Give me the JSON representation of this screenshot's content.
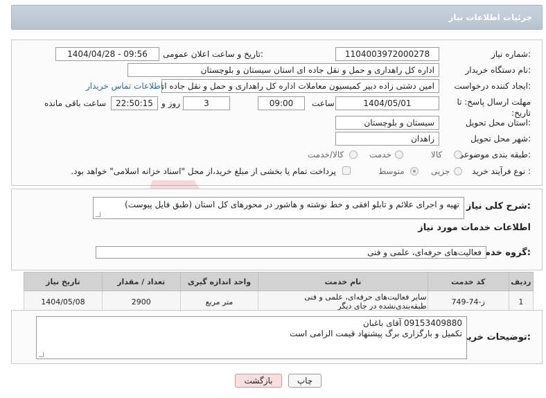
{
  "header": {
    "title": "جزئیات اطلاعات نیاز"
  },
  "form": {
    "need_number_label": "شماره نیاز:",
    "need_number": "1104003972000278",
    "announce_label": "تاریخ و ساعت اعلان عمومی:",
    "announce_value": "1404/04/28 - 09:56",
    "buyer_org_label": "نام دستگاه خریدار:",
    "buyer_org": "اداره کل راهداری و حمل و نقل جاده ای استان سیستان و بلوچستان",
    "requester_label": "ایجاد کننده درخواست:",
    "requester": "امین دشتی زاده دبیر کمیسیون معاملات اداره کل راهداری و حمل و نقل جاده ای",
    "contact_link": "اطلاعات تماس خریدار",
    "deadline_label": "مهلت ارسال پاسخ: تا تاریخ:",
    "deadline_date": "1404/05/01",
    "time_label": "ساعت",
    "deadline_time": "09:00",
    "days_value": "3",
    "days_label": "روز و",
    "remaining_time": "22:50:15",
    "remaining_label": "ساعت باقی مانده",
    "province_label": "استان محل تحویل:",
    "province": "سیستان و بلوچستان",
    "city_label": "شهر محل تحویل:",
    "city": "زاهدان",
    "category_label": "طبقه بندی موضوعی:",
    "category_options": [
      "کالا",
      "خدمت",
      "کالا/خدمت"
    ],
    "process_label": "نوع فرآیند خرید :",
    "process_options": [
      "جزیی",
      "متوسط"
    ],
    "payment_note": "پرداخت تمام یا بخشی از مبلغ خرید،از محل \"اسناد خزانه اسلامی\" خواهد بود."
  },
  "description": {
    "label": "شرح کلی نیاز:",
    "value": "تهیه و اجرای علائم و تابلو افقی و خط نوشته و هاشور در محورهای کل استان (طبق فایل پیوست)"
  },
  "services": {
    "section_title": "اطلاعات خدمات مورد نیاز",
    "group_label": "گروه خدمت:",
    "group_value": "فعالیت‌های حرفه‌ای، علمی و فنی",
    "columns": [
      "ردیف",
      "کد خدمت",
      "نام خدمت",
      "واحد اندازه گیری",
      "تعداد / مقدار",
      "تاریخ نیاز"
    ],
    "rows": [
      [
        "1",
        "ز-74-749",
        "سایر فعالیت‌های حرفه‌ای، علمی و فنی طبقه‌بندی‌نشده در جای دیگر",
        "متر مربع",
        "2900",
        "1404/05/08"
      ]
    ]
  },
  "buyer_notes": {
    "label": "توضیحات خریدار:",
    "line1": "09153409880 آقای باغبان",
    "line2": "تکمیل و بارگزاری برگ پیشنهاد قیمت الزامی است"
  },
  "buttons": {
    "print": "چاپ",
    "back": "بازگشت"
  },
  "watermark": {
    "text": "AriaTender.neT"
  },
  "colors": {
    "header_bg": "#b6c3d0",
    "link": "#1f6fb2",
    "back_button": "#f8dede"
  }
}
